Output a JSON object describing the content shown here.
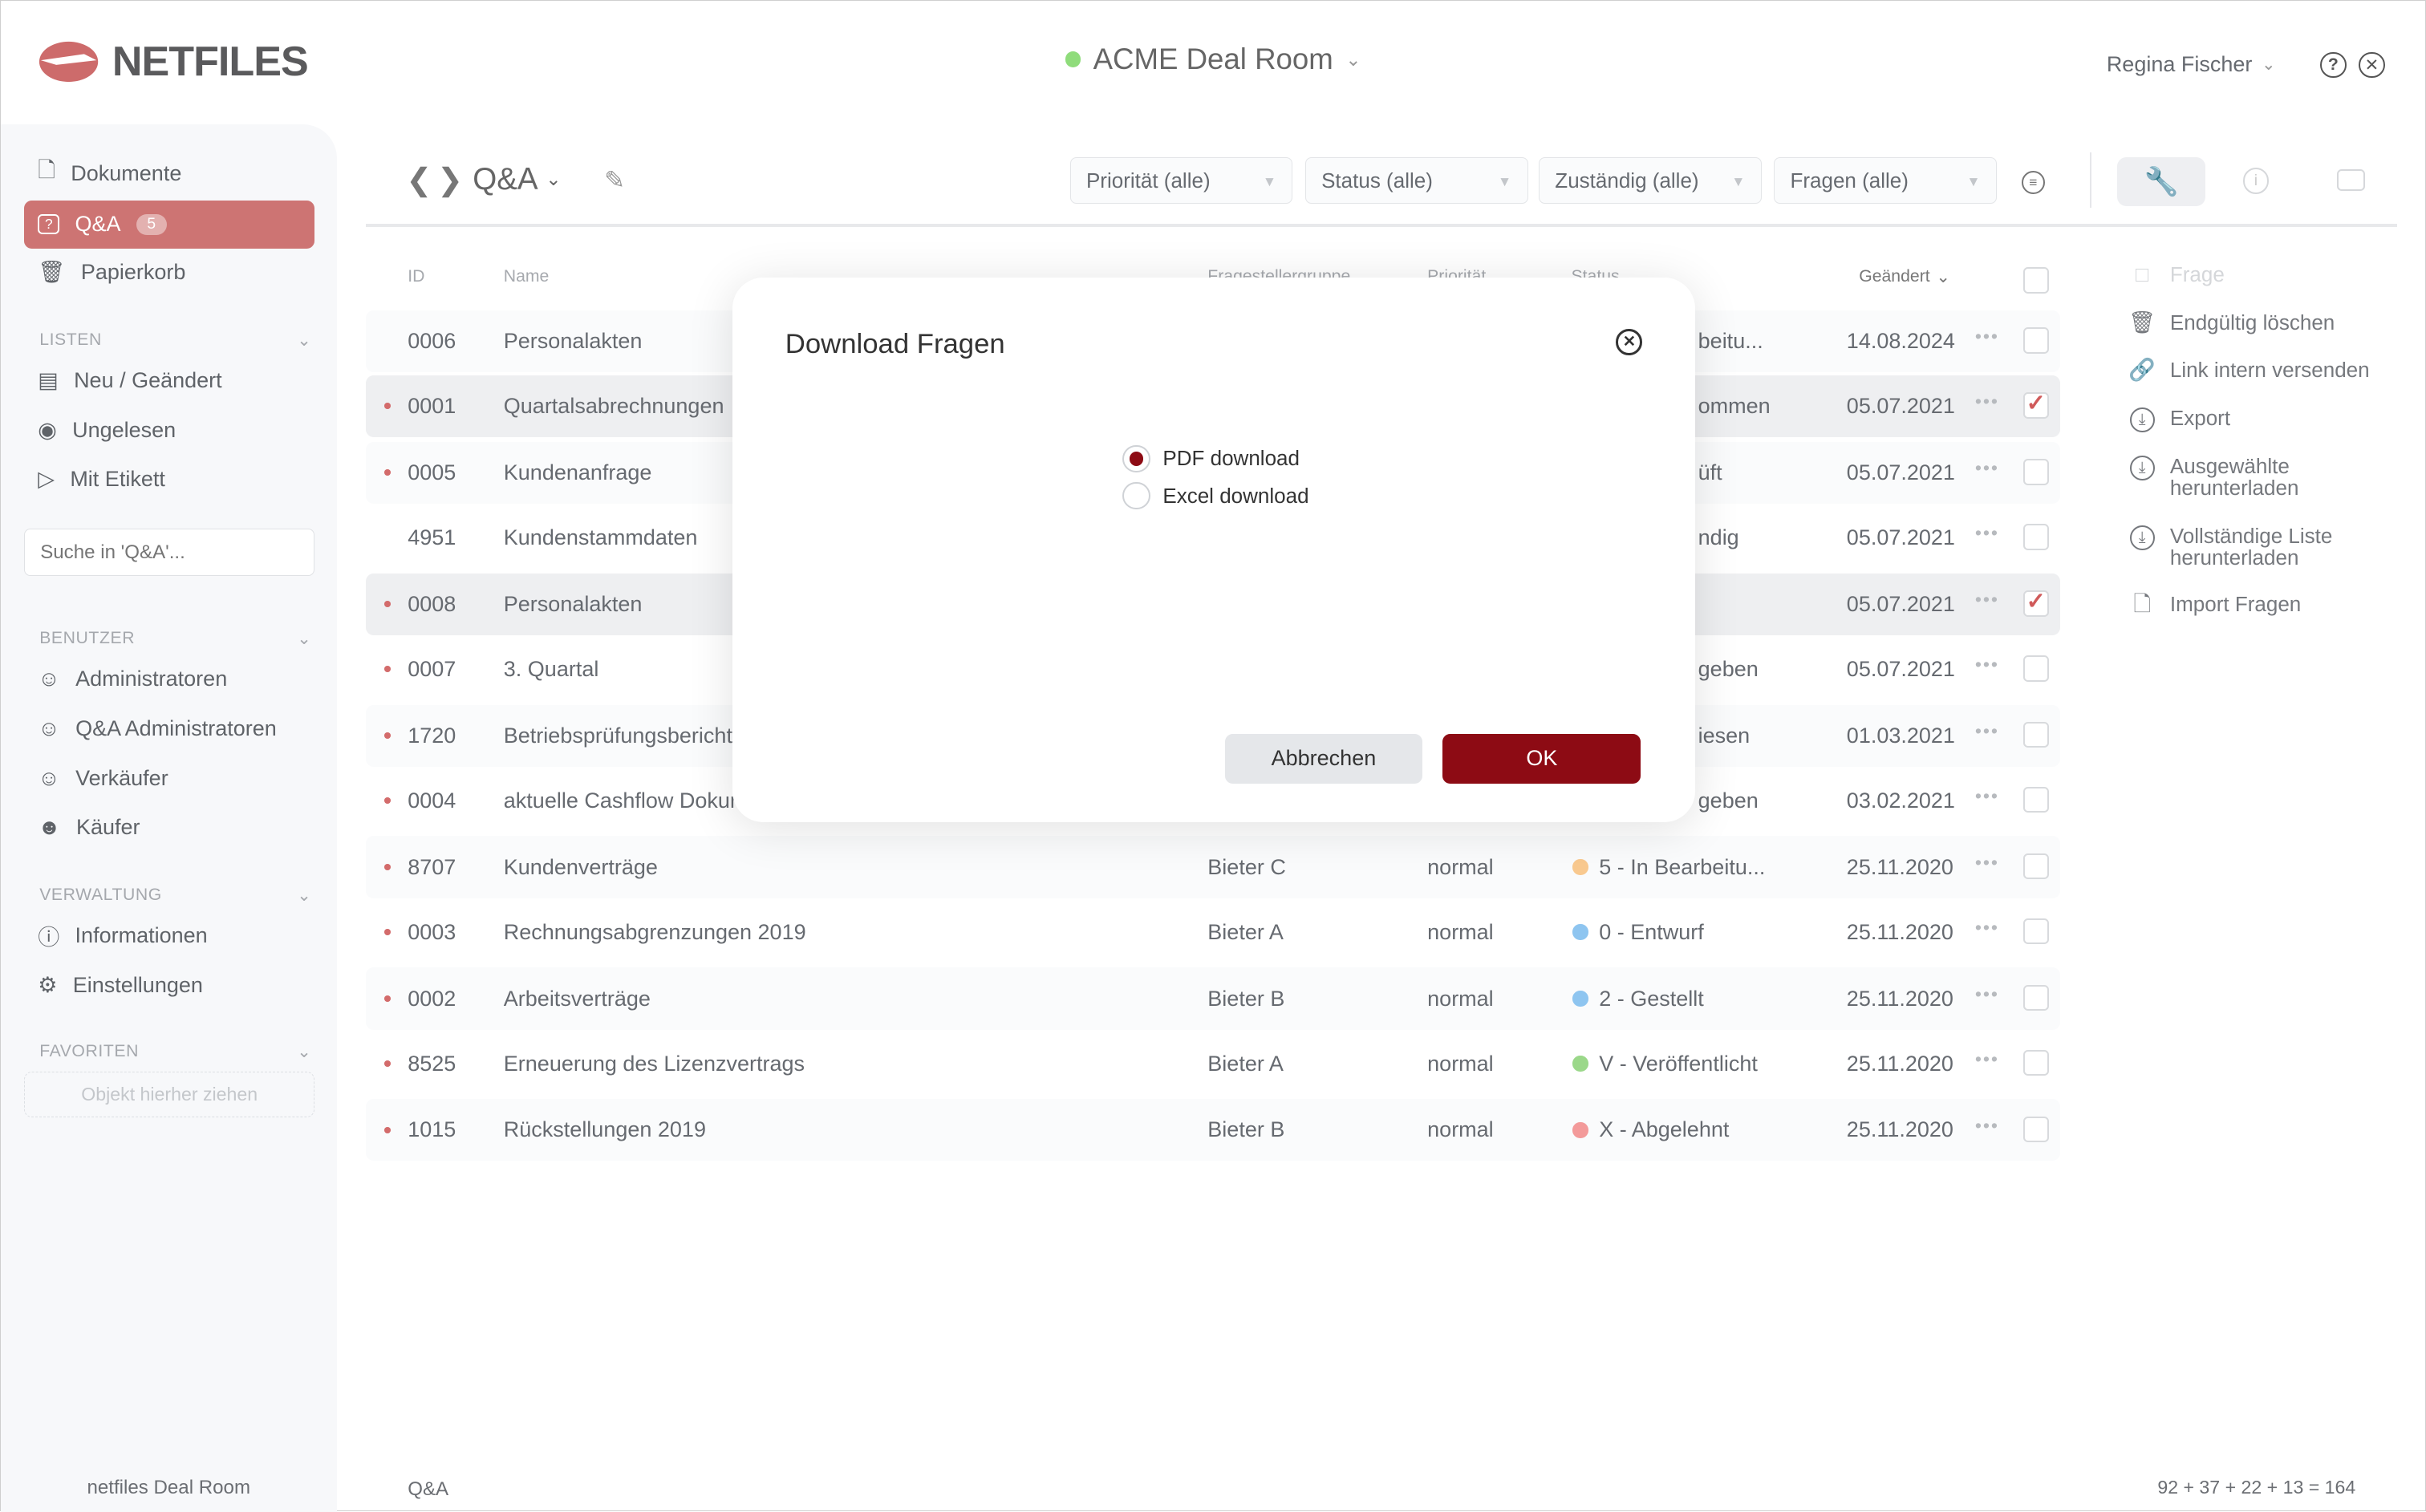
{
  "header": {
    "logo_text": "NETFILES",
    "room_name": "ACME Deal Room",
    "user_name": "Regina Fischer"
  },
  "sidebar": {
    "items": [
      {
        "label": "Dokumente"
      },
      {
        "label": "Q&A",
        "badge": "5"
      },
      {
        "label": "Papierkorb"
      }
    ],
    "lists": {
      "title": "LISTEN",
      "items": [
        {
          "label": "Neu / Geändert"
        },
        {
          "label": "Ungelesen"
        },
        {
          "label": "Mit Etikett"
        }
      ]
    },
    "search_placeholder": "Suche in 'Q&A'...",
    "users": {
      "title": "BENUTZER",
      "items": [
        {
          "label": "Administratoren"
        },
        {
          "label": "Q&A Administratoren"
        },
        {
          "label": "Verkäufer"
        },
        {
          "label": "Käufer"
        }
      ]
    },
    "admin": {
      "title": "VERWALTUNG",
      "items": [
        {
          "label": "Informationen"
        },
        {
          "label": "Einstellungen"
        }
      ]
    },
    "favorites": {
      "title": "FAVORITEN",
      "dropzone": "Objekt hierher ziehen"
    },
    "footer": "netfiles Deal Room"
  },
  "toolbar": {
    "title": "Q&A",
    "filters": [
      "Priorität (alle)",
      "Status (alle)",
      "Zuständig (alle)",
      "Fragen (alle)"
    ]
  },
  "table": {
    "headers": {
      "id": "ID",
      "name": "Name",
      "asker": "Fragestellergruppe",
      "priority": "Priorität",
      "status": "Status",
      "changed": "Geändert"
    },
    "rows": [
      {
        "id": "0006",
        "name": "Personalakten",
        "status_partial": "beitu...",
        "date": "14.08.2024",
        "unread": false,
        "checked": false
      },
      {
        "id": "0001",
        "name": "Quartalsabrechnungen",
        "status_partial": "ommen",
        "date": "05.07.2021",
        "unread": true,
        "checked": true
      },
      {
        "id": "0005",
        "name": "Kundenanfrage",
        "status_partial": "üft",
        "date": "05.07.2021",
        "unread": true,
        "checked": false
      },
      {
        "id": "4951",
        "name": "Kundenstammdaten",
        "status_partial": "ndig",
        "date": "05.07.2021",
        "unread": false,
        "checked": false
      },
      {
        "id": "0008",
        "name": "Personalakten",
        "status_partial": "",
        "date": "05.07.2021",
        "unread": true,
        "checked": true
      },
      {
        "id": "0007",
        "name": "3. Quartal",
        "status_partial": "geben",
        "date": "05.07.2021",
        "unread": true,
        "checked": false
      },
      {
        "id": "1720",
        "name": "Betriebsprüfungsbericht",
        "status_partial": "iesen",
        "date": "01.03.2021",
        "unread": true,
        "checked": false
      },
      {
        "id": "0004",
        "name": "aktuelle Cashflow Dokum",
        "status_partial": "geben",
        "date": "03.02.2021",
        "unread": true,
        "checked": false
      },
      {
        "id": "8707",
        "name": "Kundenverträge",
        "asker": "Bieter C",
        "priority": "normal",
        "status": "5 - In Bearbeitu...",
        "status_color": "#f9c98f",
        "date": "25.11.2020",
        "unread": true,
        "checked": false
      },
      {
        "id": "0003",
        "name": "Rechnungsabgrenzungen 2019",
        "asker": "Bieter A",
        "priority": "normal",
        "status": "0 - Entwurf",
        "status_color": "#8ec5f0",
        "date": "25.11.2020",
        "unread": true,
        "checked": false
      },
      {
        "id": "0002",
        "name": "Arbeitsverträge",
        "asker": "Bieter B",
        "priority": "normal",
        "status": "2 - Gestellt",
        "status_color": "#8ec5f0",
        "date": "25.11.2020",
        "unread": true,
        "checked": false
      },
      {
        "id": "8525",
        "name": "Erneuerung des Lizenzvertrags",
        "asker": "Bieter A",
        "priority": "normal",
        "status": "V - Veröffentlicht",
        "status_color": "#9bd88a",
        "date": "25.11.2020",
        "unread": true,
        "checked": false
      },
      {
        "id": "1015",
        "name": "Rückstellungen 2019",
        "asker": "Bieter B",
        "priority": "normal",
        "status": "X - Abgelehnt",
        "status_color": "#f39a9a",
        "date": "25.11.2020",
        "unread": true,
        "checked": false
      }
    ]
  },
  "right_panel": {
    "items": [
      {
        "label": "Frage",
        "icon": "comment"
      },
      {
        "label": "Endgültig löschen",
        "icon": "trash"
      },
      {
        "label": "Link intern versenden",
        "icon": "link"
      },
      {
        "label": "Export",
        "icon": "download"
      },
      {
        "label": "Ausgewählte herunterladen",
        "icon": "download"
      },
      {
        "label": "Vollständige Liste herunterladen",
        "icon": "download"
      },
      {
        "label": "Import Fragen",
        "icon": "file"
      }
    ]
  },
  "modal": {
    "title": "Download Fragen",
    "options": [
      {
        "label": "PDF download",
        "selected": true
      },
      {
        "label": "Excel download",
        "selected": false
      }
    ],
    "cancel": "Abbrechen",
    "ok": "OK"
  },
  "footer": {
    "section": "Q&A",
    "counts": "92 + 37 + 22 + 13 = 164"
  },
  "colors": {
    "accent": "#cd7473",
    "ok_button": "#8d0b14"
  }
}
